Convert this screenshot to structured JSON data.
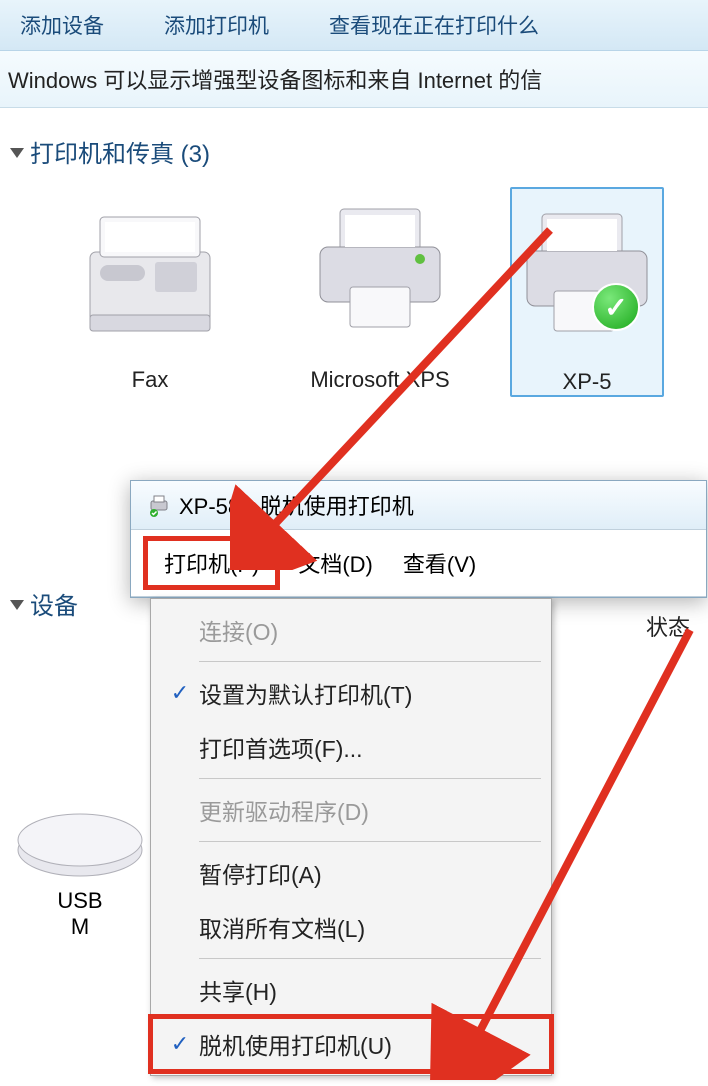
{
  "toolbar": {
    "add_device": "添加设备",
    "add_printer": "添加打印机",
    "view_printing": "查看现在正在打印什么"
  },
  "infobar": "Windows 可以显示增强型设备图标和来自 Internet 的信",
  "categories": {
    "printers": "打印机和传真 (3)",
    "devices": "设备"
  },
  "devices": {
    "fax": "Fax",
    "msxps": "Microsoft XPS",
    "xp58": "XP-5"
  },
  "usb": {
    "line1": "USB",
    "line2": "M"
  },
  "dialog": {
    "title": "XP-58  -  脱机使用打印机"
  },
  "menubar": {
    "printer": "打印机(P)",
    "document": "文档(D)",
    "view": "查看(V)"
  },
  "statusHeader": "状态",
  "menu": {
    "connect": "连接(O)",
    "set_default": "设置为默认打印机(T)",
    "preferences": "打印首选项(F)...",
    "update_driver": "更新驱动程序(D)",
    "pause": "暂停打印(A)",
    "cancel_all": "取消所有文档(L)",
    "sharing": "共享(H)",
    "offline": "脱机使用打印机(U)"
  }
}
